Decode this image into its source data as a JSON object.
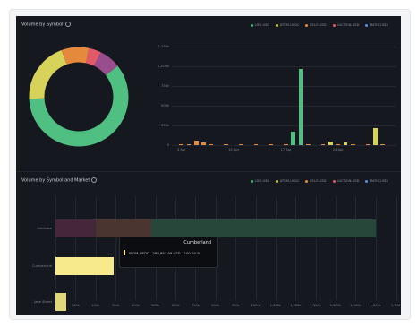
{
  "top_panel": {
    "title": "Volume by Symbol"
  },
  "bottom_panel": {
    "title": "Volume by Symbol and Market"
  },
  "legend": [
    {
      "label": "LDO-USD",
      "color": "#4fbf82"
    },
    {
      "label": "ATOM-USDC",
      "color": "#d7d35a"
    },
    {
      "label": "CELO-USD",
      "color": "#e58a3c"
    },
    {
      "label": "AUCTION-USD",
      "color": "#e05a6a"
    },
    {
      "label": "MATIC-USD",
      "color": "#5a8ee0"
    }
  ],
  "chart_data": [
    {
      "type": "pie",
      "title": "Volume by Symbol",
      "slices": [
        {
          "name": "LDO-USD",
          "value": 60,
          "color": "#4fbf82"
        },
        {
          "name": "ATOM-USDC",
          "value": 20,
          "color": "#d7d35a"
        },
        {
          "name": "CELO-USD",
          "value": 9,
          "color": "#e58a3c"
        },
        {
          "name": "AUCTION-USD",
          "value": 4,
          "color": "#e05a6a"
        },
        {
          "name": "MATIC-USD",
          "value": 7,
          "color": "#9a4d8c"
        }
      ]
    },
    {
      "type": "bar",
      "yticks": [
        "0",
        "250k",
        "500k",
        "750k",
        "1,000k",
        "1,250k"
      ],
      "ylim": [
        0,
        1250000
      ],
      "xticks": [
        "3 Apr",
        "10 Apr",
        "17 Apr",
        "24 Apr"
      ],
      "bars": [
        {
          "day": 1,
          "value": 4000,
          "color": "#e58a3c"
        },
        {
          "day": 2,
          "value": 6000,
          "color": "#e58a3c"
        },
        {
          "day": 3,
          "value": 60000,
          "color": "#e58a3c"
        },
        {
          "day": 4,
          "value": 30000,
          "color": "#e58a3c"
        },
        {
          "day": 5,
          "value": 4000,
          "color": "#e58a3c"
        },
        {
          "day": 7,
          "value": 5000,
          "color": "#e58a3c"
        },
        {
          "day": 9,
          "value": 3000,
          "color": "#e58a3c"
        },
        {
          "day": 11,
          "value": 3000,
          "color": "#e58a3c"
        },
        {
          "day": 13,
          "value": 3000,
          "color": "#e58a3c"
        },
        {
          "day": 15,
          "value": 4000,
          "color": "#e58a3c"
        },
        {
          "day": 16,
          "value": 175000,
          "color": "#4fbf82"
        },
        {
          "day": 17,
          "value": 970000,
          "color": "#4fbf82"
        },
        {
          "day": 18,
          "value": 5000,
          "color": "#e58a3c"
        },
        {
          "day": 20,
          "value": 6000,
          "color": "#e58a3c"
        },
        {
          "day": 21,
          "value": 50000,
          "color": "#d7d35a"
        },
        {
          "day": 22,
          "value": 4000,
          "color": "#e58a3c"
        },
        {
          "day": 23,
          "value": 30000,
          "color": "#d7d35a"
        },
        {
          "day": 24,
          "value": 4000,
          "color": "#e58a3c"
        },
        {
          "day": 26,
          "value": 3000,
          "color": "#e58a3c"
        },
        {
          "day": 27,
          "value": 220000,
          "color": "#d7d35a"
        },
        {
          "day": 28,
          "value": 3000,
          "color": "#e58a3c"
        }
      ]
    },
    {
      "type": "bar",
      "orientation": "horizontal",
      "categories": [
        "Coinbase",
        "Cumberland",
        "Jane Street"
      ],
      "xticks": [
        "0",
        "100k",
        "200k",
        "300k",
        "400k",
        "500k",
        "600k",
        "700k",
        "800k",
        "900k",
        "1,000k",
        "1,100k",
        "1,200k",
        "1,300k",
        "1,400k",
        "1,500k",
        "1,600k",
        "1,700"
      ],
      "xlim": [
        0,
        1700000
      ],
      "rows": [
        {
          "category": "Coinbase",
          "segments": [
            {
              "name": "AUCTION-USD",
              "value": 200000,
              "color": "#45273a"
            },
            {
              "name": "CELO-USD",
              "value": 280000,
              "color": "#4a3530"
            },
            {
              "name": "LDO-USD",
              "value": 1120000,
              "color": "#27473a"
            }
          ]
        },
        {
          "category": "Cumberland",
          "segments": [
            {
              "name": "ATOM-USDC",
              "value": 288857,
              "color": "#f6ea8c"
            }
          ]
        },
        {
          "category": "Jane Street",
          "segments": [
            {
              "name": "ATOM-USDC",
              "value": 55000,
              "color": "#e0d77a"
            }
          ]
        }
      ]
    }
  ],
  "tooltip": {
    "title": "Cumberland",
    "symbol": "ATOM-USDC",
    "value": "288,857.09 USD",
    "percent": "100.00 %"
  }
}
